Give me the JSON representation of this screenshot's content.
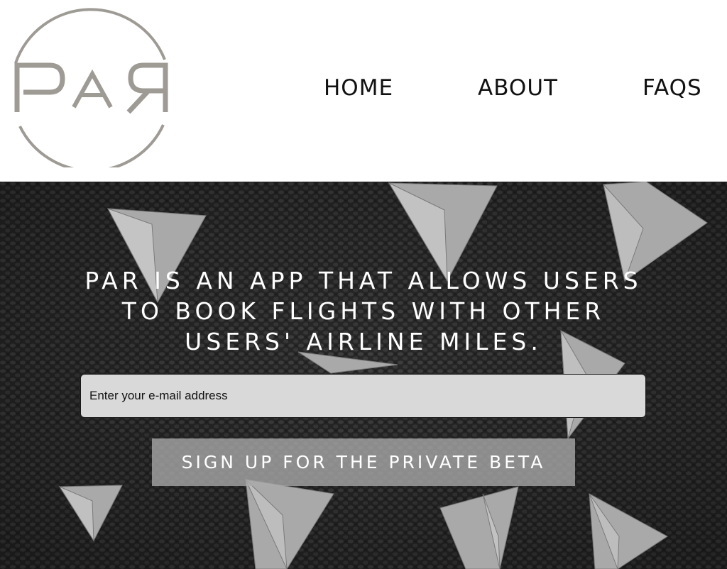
{
  "brand": {
    "logo_text": "PAR",
    "logo_color": "#9e9a94"
  },
  "nav": {
    "home": "HOME",
    "about": "ABOUT",
    "faqs": "FAQS"
  },
  "hero": {
    "headline_line1": "PAR IS AN APP THAT ALLOWS USERS",
    "headline_line2": "TO BOOK FLIGHTS WITH OTHER",
    "headline_line3": "USERS' AIRLINE MILES.",
    "background_icon": "paper-planes-on-carpet"
  },
  "signup": {
    "email_placeholder": "Enter your e-mail address",
    "email_value": "",
    "button_label": "SIGN UP FOR THE PRIVATE BETA"
  }
}
